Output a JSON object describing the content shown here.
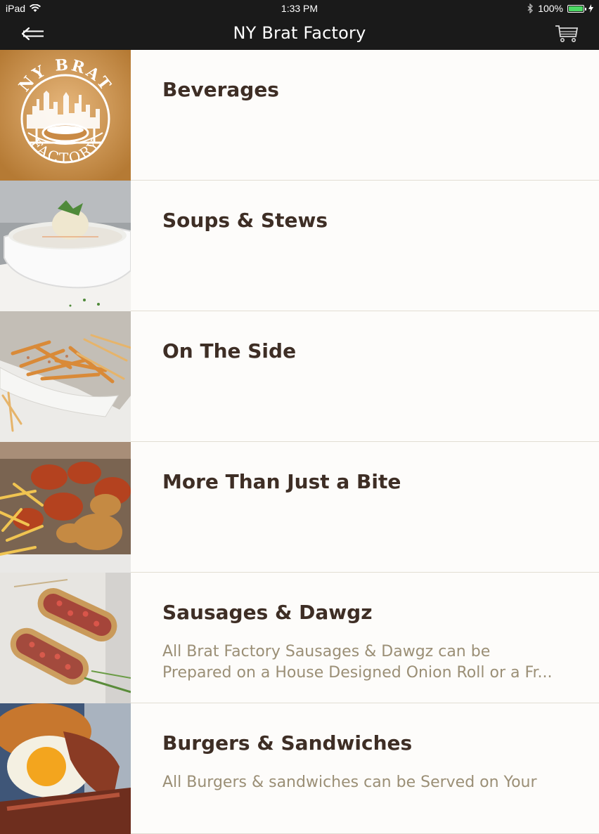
{
  "status_bar": {
    "carrier": "iPad",
    "time": "1:33 PM",
    "battery": "100%",
    "battery_level": 1.0
  },
  "nav": {
    "title": "NY Brat Factory",
    "back_icon": "arrow-left-icon",
    "cart_icon": "cart-icon"
  },
  "logo": {
    "top_text": "NY BRAT",
    "bottom_text": "FACTORY"
  },
  "categories": [
    {
      "title": "Beverages",
      "desc_line1": "",
      "desc_line2": ""
    },
    {
      "title": "Soups & Stews",
      "desc_line1": "",
      "desc_line2": ""
    },
    {
      "title": "On The Side",
      "desc_line1": "",
      "desc_line2": ""
    },
    {
      "title": "More Than Just a Bite",
      "desc_line1": "",
      "desc_line2": ""
    },
    {
      "title": "Sausages & Dawgz",
      "desc_line1": "All Brat Factory Sausages & Dawgz can be",
      "desc_line2": "Prepared on a House Designed Onion Roll or a Fr..."
    },
    {
      "title": "Burgers & Sandwiches",
      "desc_line1": "All Burgers & sandwiches can be Served on Your",
      "desc_line2": ""
    }
  ],
  "colors": {
    "bar_bg": "#1a1a1a",
    "title_text": "#3e2e25",
    "desc_text": "#9b8f76",
    "divider": "#e2ddd3"
  }
}
